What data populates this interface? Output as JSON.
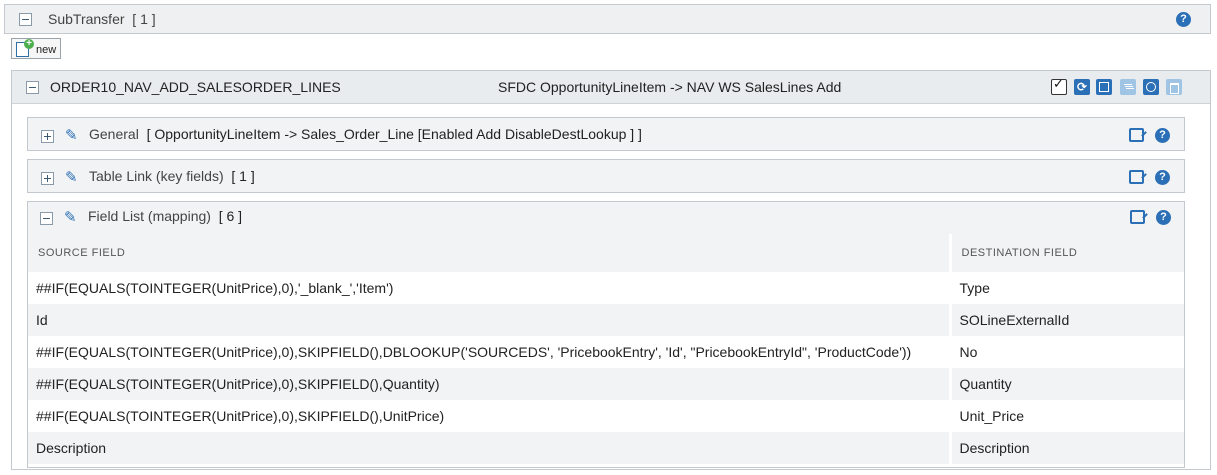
{
  "subtransfer": {
    "title": "SubTransfer",
    "count": "[ 1 ]"
  },
  "new_button": {
    "label": "new"
  },
  "order": {
    "name": "ORDER10_NAV_ADD_SALESORDER_LINES",
    "description": "SFDC OpportunityLineItem -> NAV WS SalesLines Add",
    "toolbar_icons": [
      "check-icon",
      "refresh-icon",
      "window-icon",
      "filter-icon",
      "clock-icon",
      "trash-icon"
    ]
  },
  "sections": {
    "general": {
      "title": "General",
      "summary": "[ OpportunityLineItem -> Sales_Order_Line [Enabled Add DisableDestLookup ] ]"
    },
    "table_link": {
      "title": "Table Link (key fields)",
      "summary": "[ 1 ]"
    },
    "field_list": {
      "title": "Field List (mapping)",
      "summary": "[ 6 ]"
    }
  },
  "mapping": {
    "columns": [
      "SOURCE FIELD",
      "DESTINATION FIELD"
    ],
    "rows": [
      {
        "source": "##IF(EQUALS(TOINTEGER(UnitPrice),0),'_blank_','Item')",
        "destination": "Type"
      },
      {
        "source": "Id",
        "destination": "SOLineExternalId"
      },
      {
        "source": "##IF(EQUALS(TOINTEGER(UnitPrice),0),SKIPFIELD(),DBLOOKUP('SOURCEDS', 'PricebookEntry', 'Id', \"PricebookEntryId\", 'ProductCode'))",
        "destination": "No"
      },
      {
        "source": "##IF(EQUALS(TOINTEGER(UnitPrice),0),SKIPFIELD(),Quantity)",
        "destination": "Quantity"
      },
      {
        "source": "##IF(EQUALS(TOINTEGER(UnitPrice),0),SKIPFIELD(),UnitPrice)",
        "destination": "Unit_Price"
      },
      {
        "source": "Description",
        "destination": "Description"
      }
    ]
  },
  "colors": {
    "accent": "#2b6fb6",
    "header_bg": "#e8ecef",
    "panel_bg": "#f2f3f4"
  }
}
